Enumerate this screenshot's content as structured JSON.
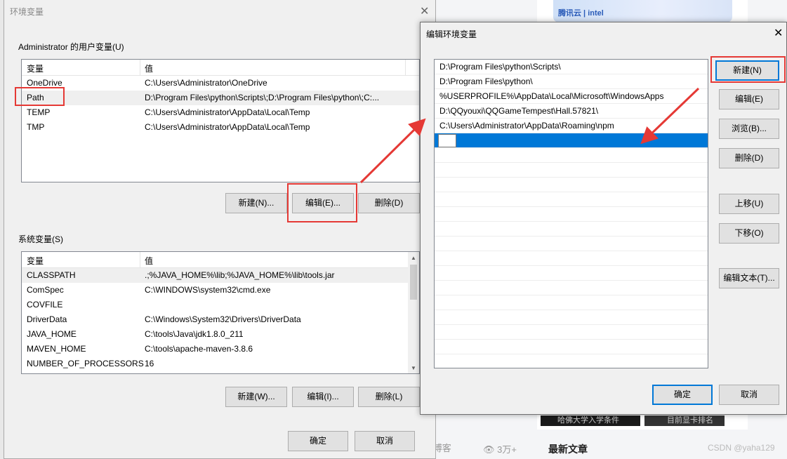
{
  "background": {
    "brand_text": "腾讯云 | intel",
    "blog_text": "py的博客",
    "views": "3万+",
    "latest_heading": "最新文章",
    "watermark": "CSDN @yaha129",
    "ad1": "哈佛大学入学条件",
    "ad2": "目前显卡排名"
  },
  "env_dialog": {
    "title": "环境变量",
    "user_group_label": "Administrator 的用户变量(U)",
    "user_vars": {
      "headers": [
        "变量",
        "值"
      ],
      "rows": [
        {
          "name": "OneDrive",
          "value": "C:\\Users\\Administrator\\OneDrive"
        },
        {
          "name": "Path",
          "value": "D:\\Program Files\\python\\Scripts\\;D:\\Program Files\\python\\;C:..."
        },
        {
          "name": "TEMP",
          "value": "C:\\Users\\Administrator\\AppData\\Local\\Temp"
        },
        {
          "name": "TMP",
          "value": "C:\\Users\\Administrator\\AppData\\Local\\Temp"
        }
      ],
      "buttons": {
        "new": "新建(N)...",
        "edit": "编辑(E)...",
        "delete": "删除(D)"
      }
    },
    "system_group_label": "系统变量(S)",
    "system_vars": {
      "headers": [
        "变量",
        "值"
      ],
      "rows": [
        {
          "name": "CLASSPATH",
          "value": ".;%JAVA_HOME%\\lib;%JAVA_HOME%\\lib\\tools.jar"
        },
        {
          "name": "ComSpec",
          "value": "C:\\WINDOWS\\system32\\cmd.exe"
        },
        {
          "name": "COVFILE",
          "value": ""
        },
        {
          "name": "DriverData",
          "value": "C:\\Windows\\System32\\Drivers\\DriverData"
        },
        {
          "name": "JAVA_HOME",
          "value": "C:\\tools\\Java\\jdk1.8.0_211"
        },
        {
          "name": "MAVEN_HOME",
          "value": "C:\\tools\\apache-maven-3.8.6"
        },
        {
          "name": "NUMBER_OF_PROCESSORS",
          "value": "16"
        }
      ],
      "buttons": {
        "new": "新建(W)...",
        "edit": "编辑(I)...",
        "delete": "删除(L)"
      }
    },
    "ok": "确定",
    "cancel": "取消"
  },
  "edit_dialog": {
    "title": "编辑环境变量",
    "paths": [
      "D:\\Program Files\\python\\Scripts\\",
      "D:\\Program Files\\python\\",
      "%USERPROFILE%\\AppData\\Local\\Microsoft\\WindowsApps",
      "D:\\QQyouxi\\QQGameTempest\\Hall.57821\\",
      "C:\\Users\\Administrator\\AppData\\Roaming\\npm"
    ],
    "buttons": {
      "new": "新建(N)",
      "edit": "编辑(E)",
      "browse": "浏览(B)...",
      "delete": "删除(D)",
      "move_up": "上移(U)",
      "move_down": "下移(O)",
      "edit_text": "编辑文本(T)..."
    },
    "ok": "确定",
    "cancel": "取消"
  },
  "colors": {
    "annotation": "#e53935",
    "selection": "#0078d7"
  }
}
